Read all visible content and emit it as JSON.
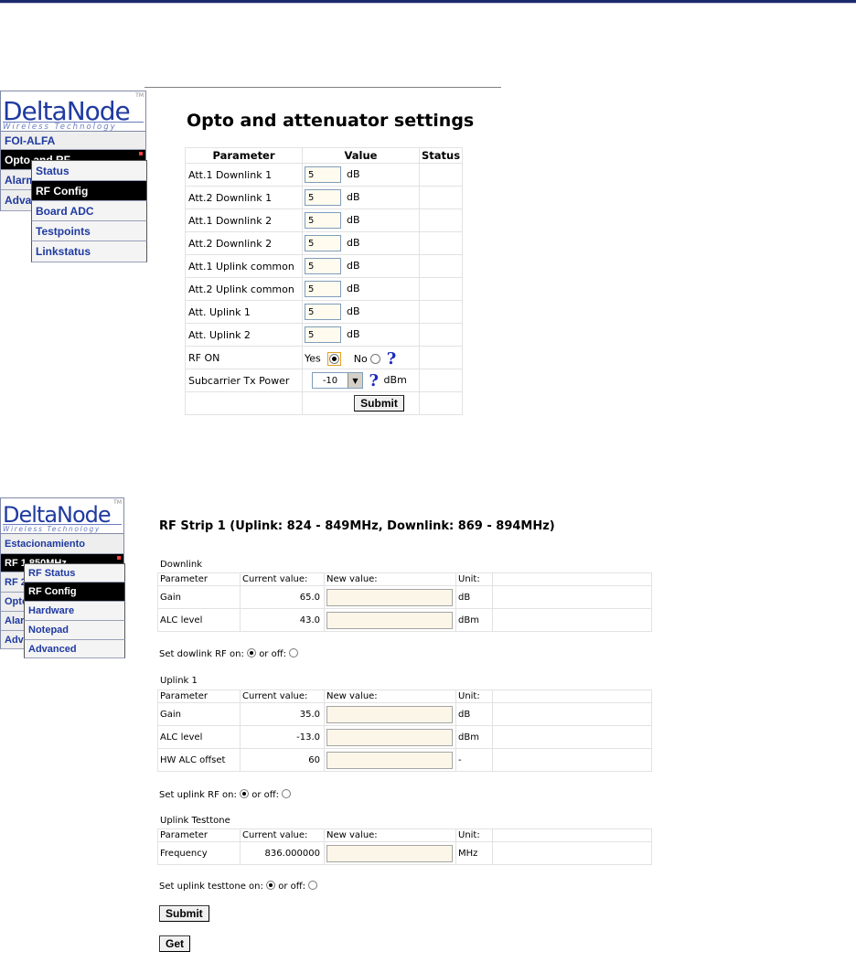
{
  "brand": {
    "name": "DeltaNode",
    "tagline": "Wireless Technology",
    "tm": "TM"
  },
  "section1": {
    "nav": {
      "items": [
        {
          "label": "FOI-ALFA"
        },
        {
          "label": "Opto and RF"
        },
        {
          "label": "Alarm"
        },
        {
          "label": "Advanced"
        }
      ],
      "submenu": [
        {
          "label": "Status"
        },
        {
          "label": "RF Config"
        },
        {
          "label": "Board ADC"
        },
        {
          "label": "Testpoints"
        },
        {
          "label": "Linkstatus"
        }
      ]
    },
    "title": "Opto and attenuator settings",
    "headers": {
      "parameter": "Parameter",
      "value": "Value",
      "status": "Status"
    },
    "rows": [
      {
        "param": "Att.1 Downlink 1",
        "value": "5",
        "unit": "dB"
      },
      {
        "param": "Att.2 Downlink 1",
        "value": "5",
        "unit": "dB"
      },
      {
        "param": "Att.1 Downlink 2",
        "value": "5",
        "unit": "dB"
      },
      {
        "param": "Att.2 Downlink 2",
        "value": "5",
        "unit": "dB"
      },
      {
        "param": "Att.1 Uplink common",
        "value": "5",
        "unit": "dB"
      },
      {
        "param": "Att.2 Uplink common",
        "value": "5",
        "unit": "dB"
      },
      {
        "param": "Att. Uplink 1",
        "value": "5",
        "unit": "dB"
      },
      {
        "param": "Att. Uplink 2",
        "value": "5",
        "unit": "dB"
      }
    ],
    "rf_on": {
      "label": "RF ON",
      "yes": "Yes",
      "no": "No",
      "help": "?"
    },
    "subcarrier": {
      "label": "Subcarrier Tx Power",
      "value": "-10",
      "unit": "dBm",
      "help": "?"
    },
    "submit": "Submit"
  },
  "section2": {
    "nav": {
      "items": [
        {
          "label": "Estacionamiento"
        },
        {
          "label": "RF 1 850MHz"
        },
        {
          "label": "RF 2"
        },
        {
          "label": "Opto"
        },
        {
          "label": "Alarm"
        },
        {
          "label": "Advanced"
        }
      ],
      "submenu": [
        {
          "label": "RF Status"
        },
        {
          "label": "RF Config"
        },
        {
          "label": "Hardware"
        },
        {
          "label": "Notepad"
        },
        {
          "label": "Advanced"
        }
      ]
    },
    "title": "RF Strip  1 (Uplink:  824 - 849MHz, Downlink:  869 - 894MHz)",
    "col_headers": {
      "parameter": "Parameter",
      "current": "Current value:",
      "new": "New value:",
      "unit": "Unit:"
    },
    "downlink": {
      "label": "Downlink",
      "rows": [
        {
          "param": "Gain",
          "current": "65.0",
          "unit": "dB"
        },
        {
          "param": "ALC level",
          "current": "43.0",
          "unit": "dBm"
        }
      ],
      "onoff": {
        "prefix": "Set dowlink RF on:",
        "or_off": "or off:"
      }
    },
    "uplink": {
      "label": "Uplink 1",
      "rows": [
        {
          "param": "Gain",
          "current": "35.0",
          "unit": "dB"
        },
        {
          "param": "ALC level",
          "current": "-13.0",
          "unit": "dBm"
        },
        {
          "param": "HW ALC offset",
          "current": "60",
          "unit": "-"
        }
      ],
      "onoff": {
        "prefix": "Set uplink RF on:",
        "or_off": "or off:"
      }
    },
    "testtone": {
      "label": "Uplink Testtone",
      "rows": [
        {
          "param": "Frequency",
          "current": "836.000000",
          "unit": "MHz"
        }
      ],
      "onoff": {
        "prefix": "Set uplink testtone on:",
        "or_off": "or off:"
      }
    },
    "submit": "Submit",
    "get": "Get"
  }
}
